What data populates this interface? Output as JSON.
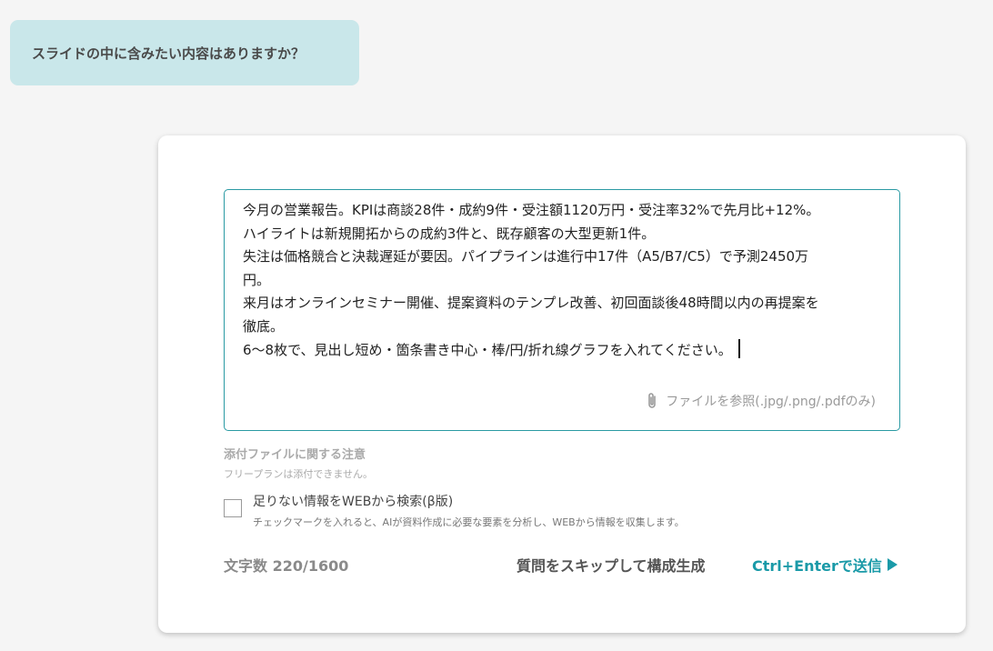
{
  "bot_message": {
    "text": "スライドの中に含みたい内容はありますか？"
  },
  "composer": {
    "lines": [
      "今月の営業報告。KPIは商談28件・成約9件・受注額1120万円・受注率32%で先月比+12%。",
      "ハイライトは新規開拓からの成約3件と、既存顧客の大型更新1件。",
      "失注は価格競合と決裁遅延が要因。パイプラインは進行中17件（A5/B7/C5）で予測2450万",
      "円。",
      "来月はオンラインセミナー開催、提案資料のテンプレ改善、初回面談後48時間以内の再提案を",
      "徹底。",
      "6〜8枚で、見出し短め・箇条書き中心・棒/円/折れ線グラフを入れてください。"
    ],
    "attach_label": "ファイルを参照(.jpg/.png/.pdfのみ)",
    "attach_icon": "paperclip-icon"
  },
  "attachment_note": {
    "title": "添付ファイルに関する注意",
    "text": "フリープランは添付できません。"
  },
  "web_search": {
    "checked": false,
    "label": "足りない情報をWEBから検索(β版)",
    "description": "チェックマークを入れると、AIが資料作成に必要な要素を分析し、WEBから情報を収集します。"
  },
  "footer": {
    "char_count": "文字数 220/1600",
    "skip_label": "質問をスキップして構成生成",
    "send_label": "Ctrl+Enterで送信",
    "send_icon": "play-icon"
  },
  "colors": {
    "accent": "#1a9aa8",
    "bubble": "#c9e7ea",
    "input_border": "#2a9aa3"
  }
}
